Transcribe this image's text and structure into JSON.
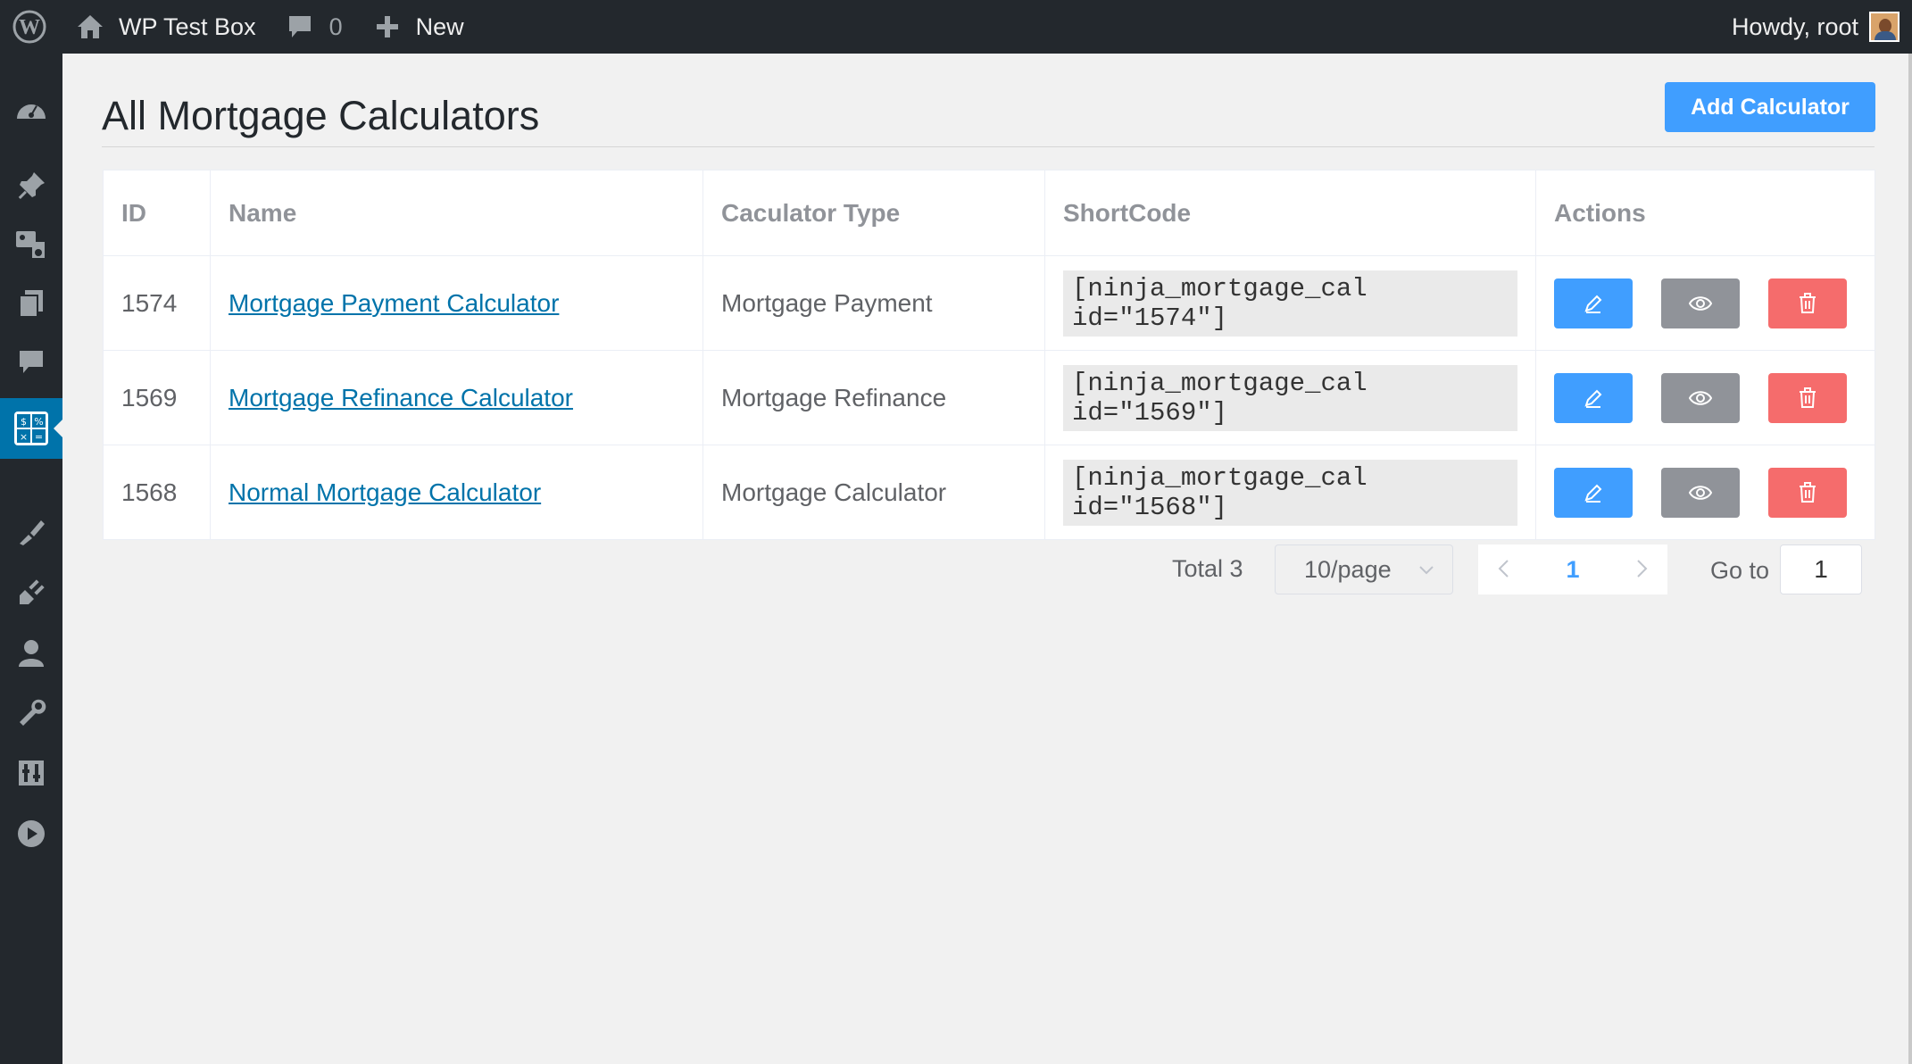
{
  "adminbar": {
    "site_name": "WP Test Box",
    "comments_count": "0",
    "new_label": "New",
    "howdy": "Howdy, root"
  },
  "page": {
    "title": "All Mortgage Calculators",
    "add_button": "Add Calculator"
  },
  "table": {
    "headers": [
      "ID",
      "Name",
      "Caculator Type",
      "ShortCode",
      "Actions"
    ],
    "rows": [
      {
        "id": "1574",
        "name": "Mortgage Payment Calculator",
        "type": "Mortgage Payment",
        "shortcode": "[ninja_mortgage_cal id=\"1574\"]"
      },
      {
        "id": "1569",
        "name": "Mortgage Refinance Calculator",
        "type": "Mortgage Refinance",
        "shortcode": "[ninja_mortgage_cal id=\"1569\"]"
      },
      {
        "id": "1568",
        "name": "Normal Mortgage Calculator",
        "type": "Mortgage Calculator",
        "shortcode": "[ninja_mortgage_cal id=\"1568\"]"
      }
    ]
  },
  "pagination": {
    "total": "Total 3",
    "page_size": "10/page",
    "current_page": "1",
    "goto_label": "Go to",
    "goto_value": "1"
  },
  "colors": {
    "primary": "#409eff",
    "info": "#909399",
    "danger": "#f56c6c",
    "adminbar": "#23282d",
    "active_menu": "#0073aa"
  },
  "icons": {
    "edit": "pencil-icon",
    "view": "eye-icon",
    "delete": "trash-icon"
  }
}
